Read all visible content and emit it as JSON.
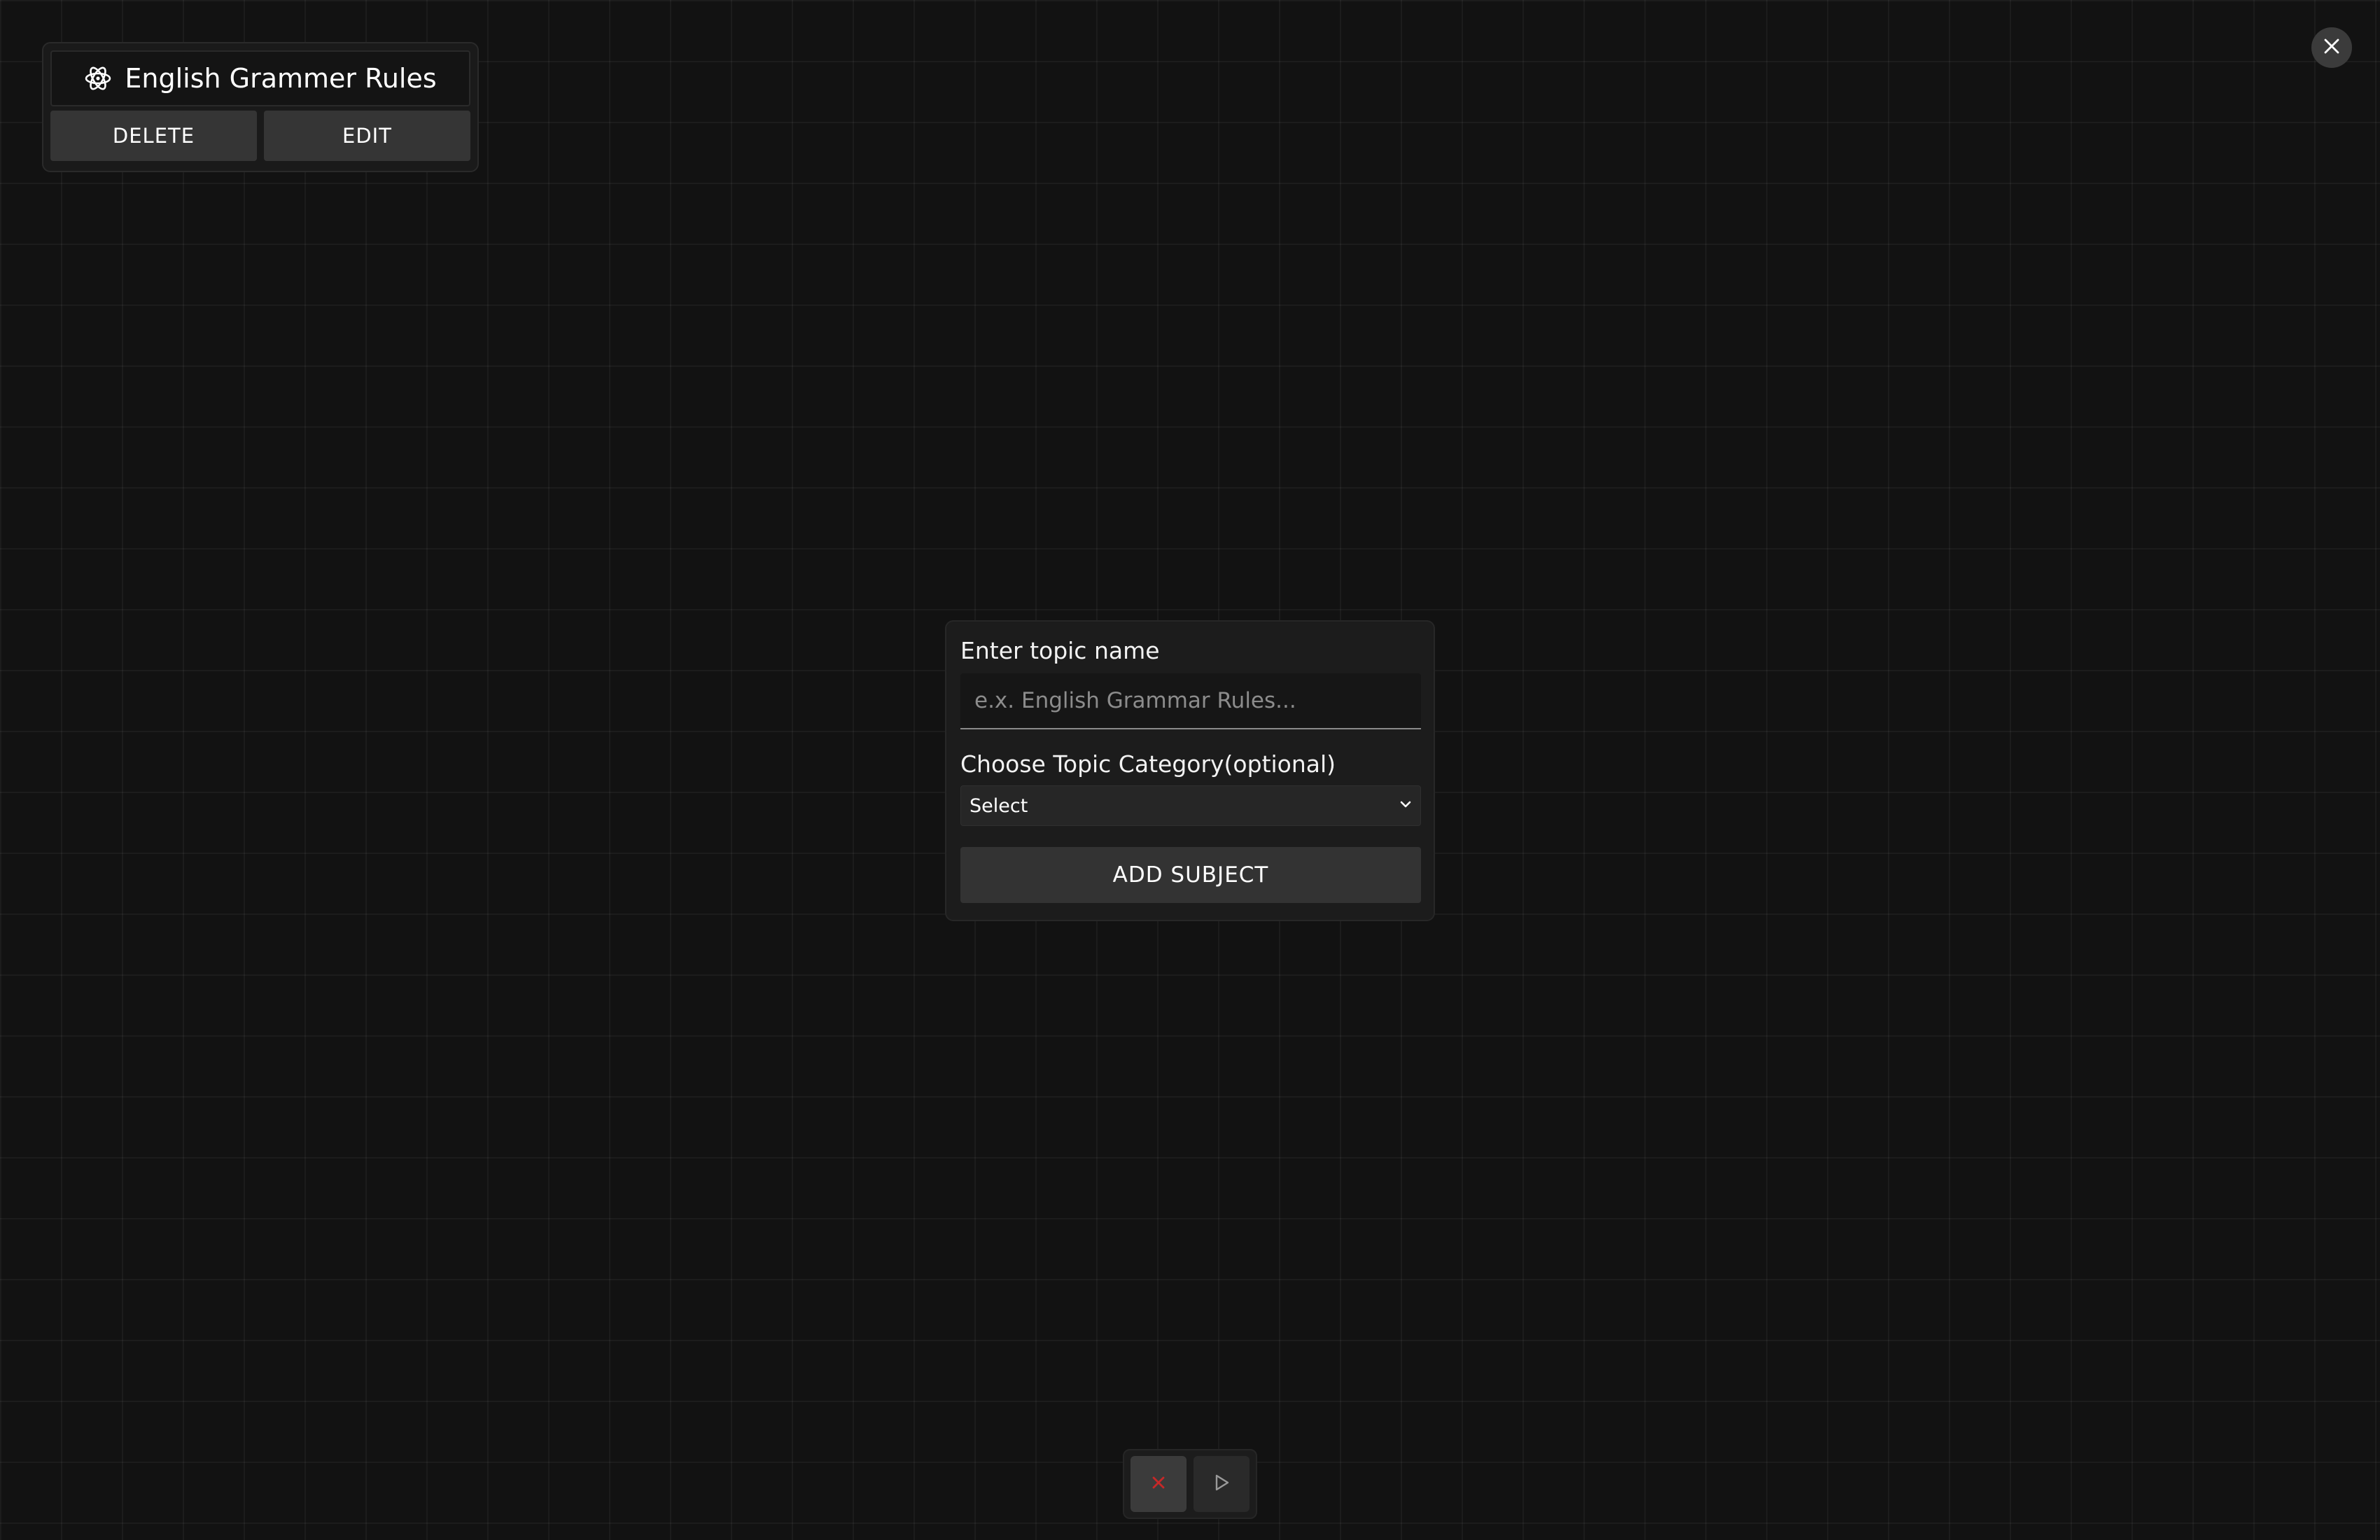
{
  "topic_card": {
    "title": "English Grammer Rules",
    "icon": "atom-icon",
    "delete_label": "DELETE",
    "edit_label": "EDIT"
  },
  "close_button": {
    "icon": "close-icon"
  },
  "form": {
    "topic_label": "Enter topic name",
    "topic_placeholder": "e.x. English Grammar Rules...",
    "topic_value": "",
    "category_label": "Choose Topic Category(optional)",
    "category_selected": "Select",
    "submit_label": "ADD SUBJECT"
  },
  "toolbar": {
    "cancel_icon": "x-icon",
    "play_icon": "play-icon",
    "cancel_color": "#c62828"
  },
  "colors": {
    "background": "#121212",
    "panel": "#1c1c1c",
    "button": "#333333"
  }
}
